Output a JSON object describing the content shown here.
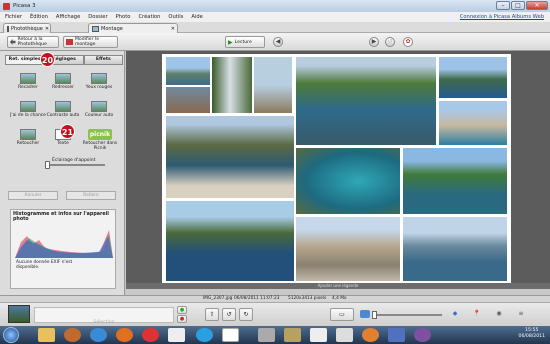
{
  "window": {
    "title": "Picasa 3"
  },
  "menu": {
    "items": [
      "Fichier",
      "Édition",
      "Affichage",
      "Dossier",
      "Photo",
      "Création",
      "Outils",
      "Aide"
    ],
    "albums_link": "Connexion à Picasa Albums Web"
  },
  "tabs": [
    {
      "label": "Photothèque"
    },
    {
      "label": "Montage"
    }
  ],
  "toolbar": {
    "back_label": "Retour à la Photothèque",
    "edit_montage_label": "Modifier le montage",
    "play_label": "Lecture"
  },
  "panel": {
    "tabs": [
      "Ret. simples",
      "Réglages",
      "Effets"
    ],
    "tools": [
      {
        "label": "Recadrer"
      },
      {
        "label": "Redresser"
      },
      {
        "label": "Yeux rouges"
      },
      {
        "label": "J'ai de la chance"
      },
      {
        "label": "Contraste auto"
      },
      {
        "label": "Couleur auto"
      },
      {
        "label": "Retoucher"
      },
      {
        "label": "Texte"
      },
      {
        "label": "Retoucher dans Picnik"
      }
    ],
    "picnik_logo": "picnik",
    "fill_light_label": "Éclairage d'appoint",
    "fill_light_value": 0,
    "undo_label": "Annuler",
    "redo_label": "Refaire",
    "histogram_title": "Histogramme et infos sur l'appareil photo",
    "no_exif_text": "Aucune donnée EXIF n'est disponible."
  },
  "badges": {
    "b20": "20",
    "b21": "21"
  },
  "status": {
    "caption_placeholder": "Ajouter une légende"
  },
  "infobar": {
    "filename": "IMG_2307.jpg",
    "date": "06/08/2011 11:07:23",
    "dimensions": "5120x3413 pixels",
    "size": "4,4 Mo"
  },
  "bottombar": {
    "selection_label": "Sélection"
  },
  "clock": {
    "time": "15:55",
    "date": "06/08/2011"
  },
  "colors": {
    "accent_red": "#c1121f",
    "canvas": "#5c5c5c"
  }
}
